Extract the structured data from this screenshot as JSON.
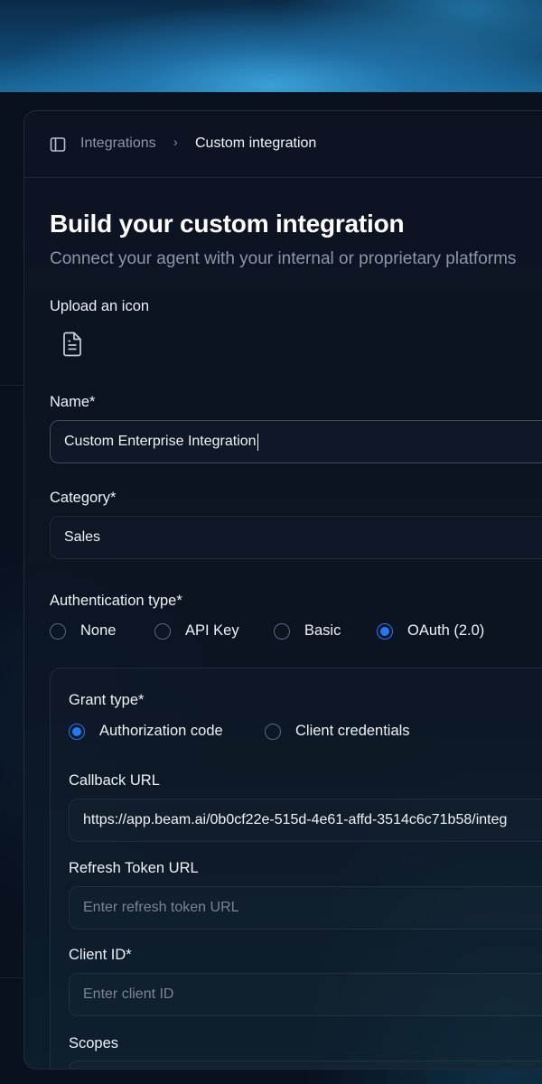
{
  "breadcrumb": {
    "parent": "Integrations",
    "separator": "›",
    "current": "Custom integration"
  },
  "header": {
    "title": "Build your custom integration",
    "subtitle": "Connect your agent with your internal or proprietary platforms"
  },
  "form": {
    "upload_label": "Upload an icon",
    "name_label": "Name*",
    "name_value": "Custom Enterprise Integration",
    "category_label": "Category*",
    "category_value": "Sales",
    "auth_label": "Authentication type*",
    "auth_options": [
      "None",
      "API Key",
      "Basic",
      "OAuth (2.0)"
    ],
    "auth_selected": "OAuth (2.0)"
  },
  "oauth": {
    "grant_label": "Grant type*",
    "grant_options": [
      "Authorization code",
      "Client credentials"
    ],
    "grant_selected": "Authorization code",
    "callback_label": "Callback URL",
    "callback_value": "https://app.beam.ai/0b0cf22e-515d-4e61-affd-3514c6c71b58/integ",
    "refresh_label": "Refresh Token URL",
    "refresh_placeholder": "Enter refresh token URL",
    "client_id_label": "Client ID*",
    "client_id_placeholder": "Enter client ID",
    "scopes_label": "Scopes"
  },
  "icons": {
    "sidebar": "sidebar-toggle-icon",
    "upload": "document-icon",
    "separator": "chevron-right-icon"
  },
  "colors": {
    "accent": "#1f7aff",
    "muted_text": "#8d96a7"
  }
}
